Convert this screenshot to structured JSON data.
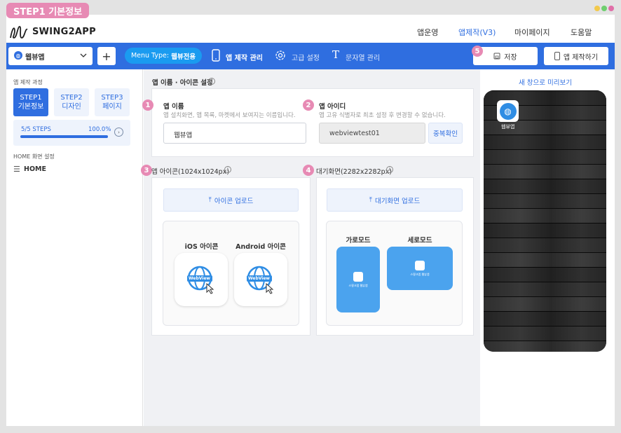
{
  "step_tag": "STEP1 기본정보",
  "window_dots": [
    "#f2c94c",
    "#6fcf6f",
    "#e06fa8"
  ],
  "header": {
    "logo": "SWING2APP",
    "nav": [
      "앱운영",
      "앱제작(V3)",
      "마이페이지",
      "도움말"
    ],
    "active_nav": "앱제작(V3)"
  },
  "toolbar": {
    "app_select": "웹뷰앱",
    "add_label": "+",
    "menu_type_prefix": "Menu Type:",
    "menu_type_value": "웹뷰전용",
    "items": [
      "앱 제작 관리",
      "고급 설정",
      "문자열 관리"
    ],
    "save_label": "저장",
    "build_label": "앱 제작하기",
    "save_badge": "5"
  },
  "sidebar": {
    "section_title": "앱 제작 과정",
    "steps": [
      {
        "line1": "STEP1",
        "line2": "기본정보",
        "active": true
      },
      {
        "line1": "STEP2",
        "line2": "디자인",
        "active": false
      },
      {
        "line1": "STEP3",
        "line2": "페이지",
        "active": false
      }
    ],
    "progress_label": "5/5 STEPS",
    "progress_percent": "100.0%",
    "progress_value": 1.0,
    "home_section": "HOME 화면 설정",
    "home_item": "HOME"
  },
  "main": {
    "section_title": "앱 이름 · 아이콘 설정",
    "app_name": {
      "badge": "1",
      "label": "앱 이름",
      "hint": "앱 설치화면, 앱 목록, 마켓에서 보여지는 이름입니다.",
      "value": "웹뷰앱"
    },
    "app_id": {
      "badge": "2",
      "label": "앱 아이디",
      "hint": "앱 고유 식별자로 최초 설정 후 변경할 수 없습니다.",
      "value": "webviewtest01",
      "check_label": "중복확인"
    },
    "icon": {
      "badge": "3",
      "label": "앱 아이콘(1024x1024px)",
      "upload_label": "아이콘 업로드",
      "ios_label": "iOS 아이콘",
      "android_label": "Android 아이콘",
      "icon_text": "WebView"
    },
    "splash": {
      "badge": "4",
      "label": "대기화면(2282x2282px)",
      "upload_label": "대기화면 업로드",
      "landscape_label": "가로모드",
      "portrait_label": "세로모드",
      "splash_caption": "스윙크앱 웹뷰앱"
    }
  },
  "preview": {
    "link_label": "새 창으로 미리보기",
    "app_label": "웹뷰앱"
  }
}
